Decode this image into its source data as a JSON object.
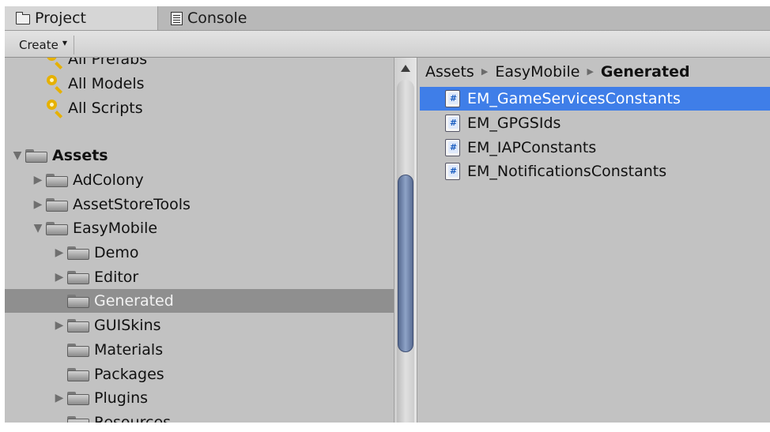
{
  "tabs": [
    {
      "label": "Project",
      "icon": "folder-icon",
      "active": true
    },
    {
      "label": "Console",
      "icon": "console-icon",
      "active": false
    }
  ],
  "toolbar": {
    "create_label": "Create",
    "create_caret": "▼"
  },
  "favorites": [
    {
      "label": "All Prefabs",
      "icon": "search-icon"
    },
    {
      "label": "All Models",
      "icon": "search-icon"
    },
    {
      "label": "All Scripts",
      "icon": "search-icon"
    }
  ],
  "tree": [
    {
      "label": "Assets",
      "arrow": "▼",
      "bold": true
    },
    {
      "label": "AdColony",
      "arrow": "▶"
    },
    {
      "label": "AssetStoreTools",
      "arrow": "▶"
    },
    {
      "label": "EasyMobile",
      "arrow": "▼"
    },
    {
      "label": "Demo",
      "arrow": "▶"
    },
    {
      "label": "Editor",
      "arrow": "▶"
    },
    {
      "label": "Generated",
      "arrow": "",
      "selected": true
    },
    {
      "label": "GUISkins",
      "arrow": "▶"
    },
    {
      "label": "Materials",
      "arrow": ""
    },
    {
      "label": "Packages",
      "arrow": ""
    },
    {
      "label": "Plugins",
      "arrow": "▶"
    },
    {
      "label": "Resources",
      "arrow": ""
    }
  ],
  "breadcrumb": [
    "Assets",
    "EasyMobile",
    "Generated"
  ],
  "breadcrumb_sep": "▶",
  "files": [
    {
      "label": "EM_GameServicesConstants",
      "icon": "csharp-script-icon",
      "selected": true
    },
    {
      "label": "EM_GPGSIds",
      "icon": "csharp-script-icon"
    },
    {
      "label": "EM_IAPConstants",
      "icon": "csharp-script-icon"
    },
    {
      "label": "EM_NotificationsConstants",
      "icon": "csharp-script-icon"
    }
  ],
  "colors": {
    "panel_bg": "#c2c2c2",
    "tree_selection": "#8f8f8f",
    "file_selection": "#3f7ee8",
    "scroll_thumb": "#7085ad"
  }
}
